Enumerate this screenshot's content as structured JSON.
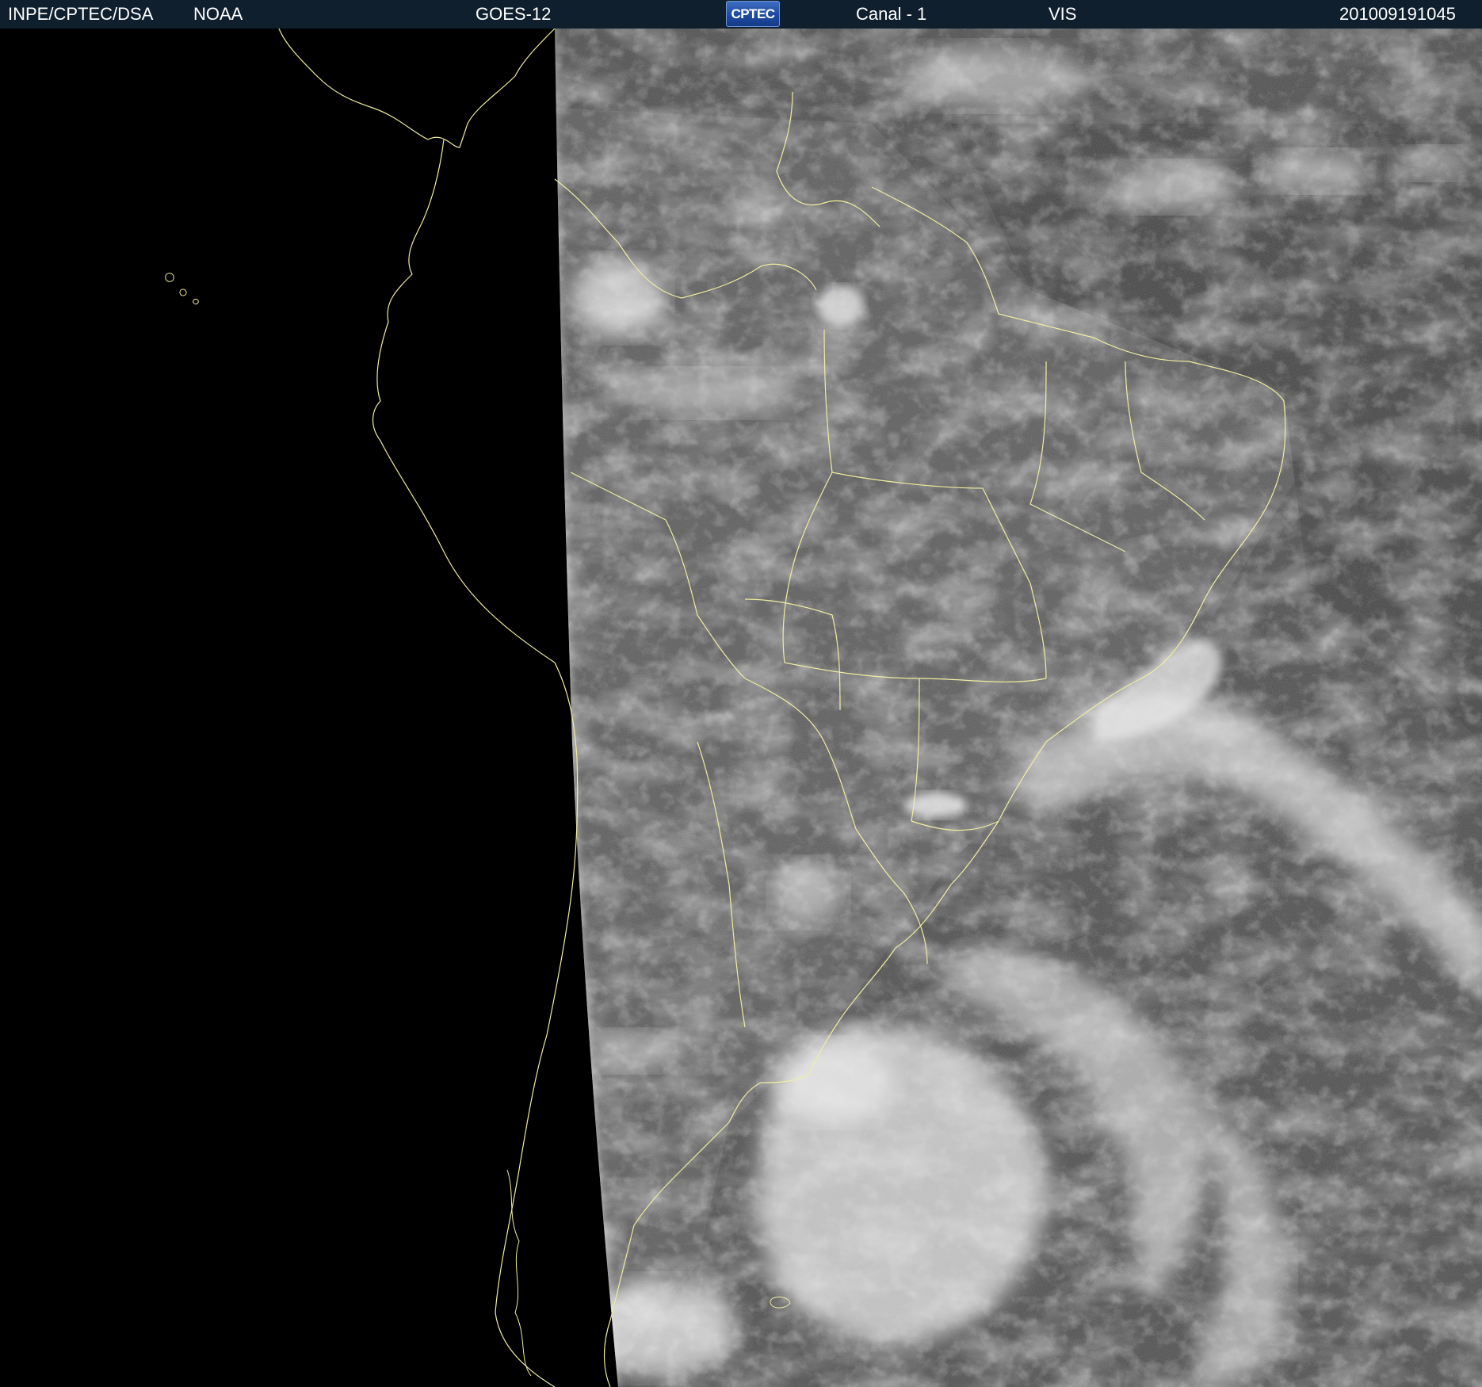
{
  "header": {
    "source": "INPE/CPTEC/DSA",
    "agency": "NOAA",
    "satellite": "GOES-12",
    "logo_text": "CPTEC",
    "channel": "Canal - 1",
    "band": "VIS",
    "timestamp": "201009191045"
  },
  "imagery": {
    "type": "visible-satellite-image",
    "background_color": "#000000",
    "border_color": "#f0eda0"
  }
}
